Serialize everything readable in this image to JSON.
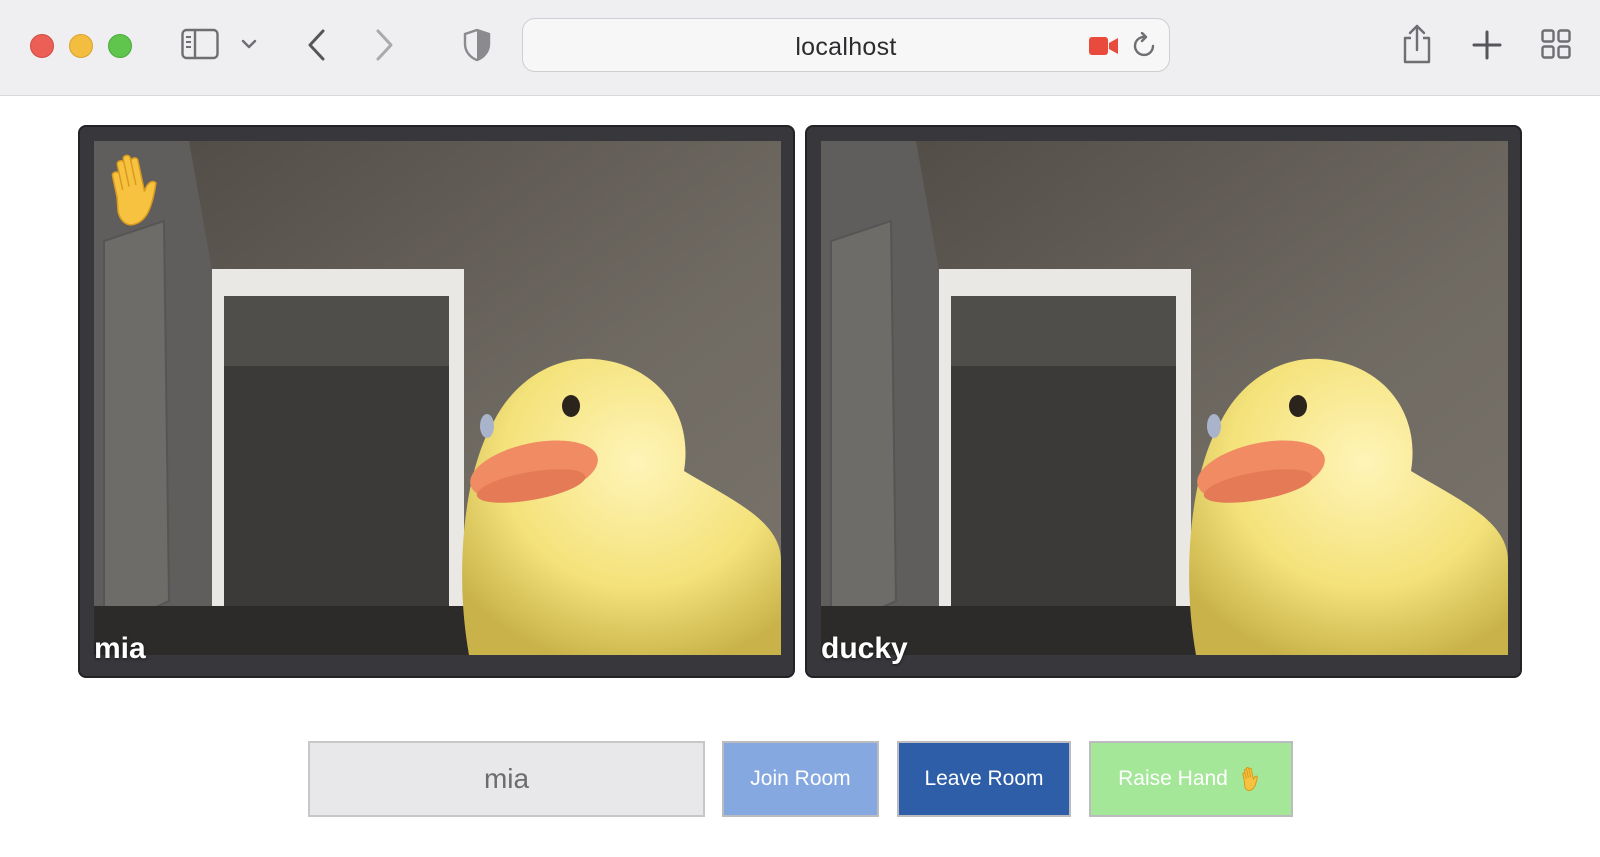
{
  "browser": {
    "url": "localhost",
    "icons": [
      "sidebar-icon",
      "chevron-down-icon",
      "back-icon",
      "forward-icon",
      "privacy-shield-icon",
      "camera-recording-icon",
      "reload-icon",
      "share-icon",
      "new-tab-icon",
      "tab-overview-icon"
    ],
    "colors": {
      "camera_indicator": "#e84a3c"
    }
  },
  "participants": [
    {
      "name": "mia",
      "hand_raised": true
    },
    {
      "name": "ducky",
      "hand_raised": false
    }
  ],
  "controls": {
    "name_value": "mia",
    "join_label": "Join Room",
    "leave_label": "Leave Room",
    "raise_label": "Raise Hand",
    "raise_icon": "raised-hand-icon",
    "colors": {
      "join": "#85a8e0",
      "leave": "#2e5ea8",
      "raise": "#a5e798"
    }
  }
}
